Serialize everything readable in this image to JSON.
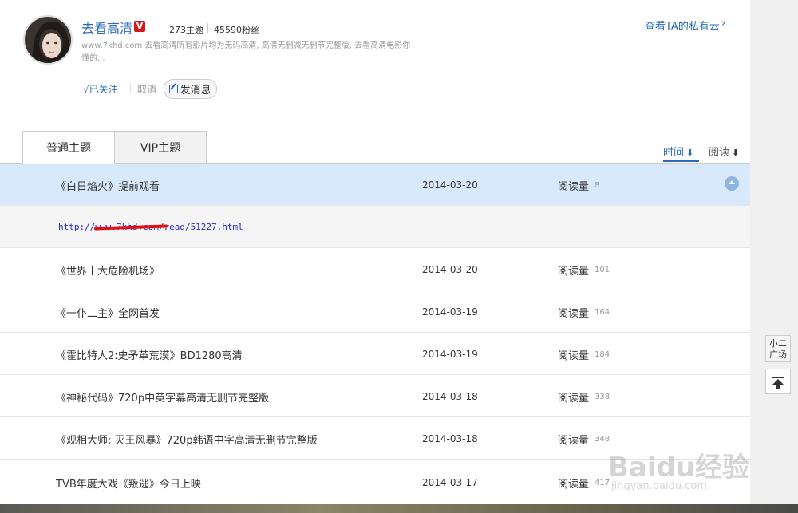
{
  "profile": {
    "username": "去看高清",
    "badge": "V",
    "topics": "273主题",
    "fans": "45590粉丝",
    "description": "www.7khd.com 去看高清所有影片均为无码高清, 高清无删减无删节完整版, 去看高清电影你懂的. .",
    "private_cloud": "查看TA的私有云",
    "private_cloud_chevron": "›",
    "followed": "√已关注",
    "cancel": "取消",
    "message": "发消息"
  },
  "tabs": [
    {
      "label": "普通主题"
    },
    {
      "label": "VIP主题"
    }
  ],
  "sort": {
    "time": "时间",
    "time_arrow": "⬇",
    "read": "阅读",
    "read_arrow": "⬇"
  },
  "rows": [
    {
      "title": "《白日焰火》提前观看",
      "date": "2014-03-20",
      "read_label": "阅读量",
      "read_count": "8"
    },
    {
      "title": "《世界十大危险机场》",
      "date": "2014-03-20",
      "read_label": "阅读量",
      "read_count": "101"
    },
    {
      "title": "《一仆二主》全网首发",
      "date": "2014-03-19",
      "read_label": "阅读量",
      "read_count": "164"
    },
    {
      "title": "《霍比特人2:史矛革荒漠》BD1280高清",
      "date": "2014-03-19",
      "read_label": "阅读量",
      "read_count": "184"
    },
    {
      "title": "《神秘代码》720p中英字幕高清无删节完整版",
      "date": "2014-03-18",
      "read_label": "阅读量",
      "read_count": "338"
    },
    {
      "title": "《观相大师: 灭王风暴》720p韩语中字高清无删节完整版",
      "date": "2014-03-18",
      "read_label": "阅读量",
      "read_count": "348"
    },
    {
      "title": "TVB年度大戏《叛逃》今日上映",
      "date": "2014-03-17",
      "read_label": "阅读量",
      "read_count": "417"
    }
  ],
  "expanded_link": "http://www.7khd.com/read/51227.html",
  "side": {
    "square": "小二广场"
  },
  "watermark": {
    "main": "Baidu经验",
    "sub": "jingyan.baidu.com"
  },
  "colors": {
    "accent": "#2a6ab8",
    "highlight_row": "#d8e9fc",
    "vip_badge": "#d21919"
  }
}
